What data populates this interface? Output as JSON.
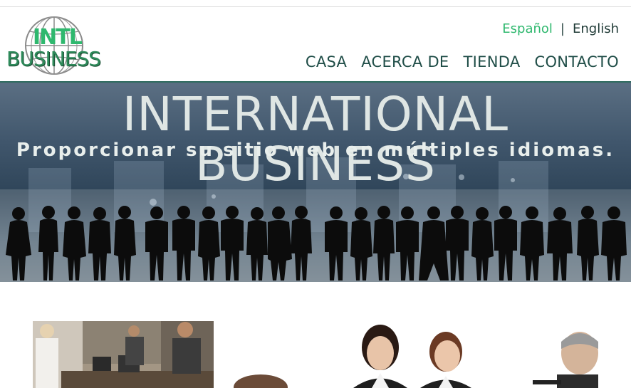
{
  "brand": {
    "logo_top": "INTL",
    "logo_bottom": "BUSINESS"
  },
  "language": {
    "active": "Español",
    "separator": "|",
    "other": "English",
    "active_color": "#2fb86e"
  },
  "nav": {
    "items": [
      {
        "label": "CASA"
      },
      {
        "label": "ACERCA DE"
      },
      {
        "label": "TIENDA"
      },
      {
        "label": "CONTACTO"
      }
    ]
  },
  "hero": {
    "title": "INTERNATIONAL BUSINESS",
    "subtitle": "Proporcionar su sitio web en múltiples idiomas."
  },
  "colors": {
    "nav_text": "#1f4d47",
    "header_border": "#2e6b5e"
  }
}
